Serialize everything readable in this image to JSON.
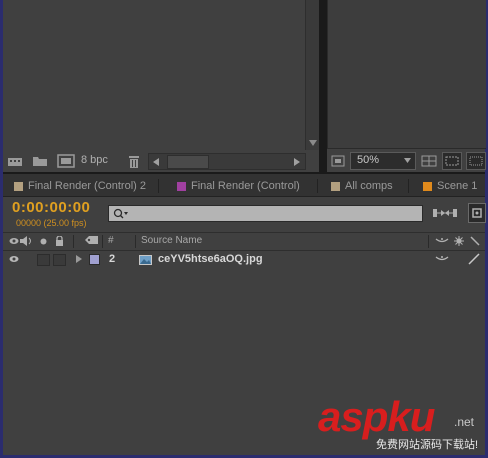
{
  "project_panel": {
    "bit_depth": "8 bpc"
  },
  "viewer_panel": {
    "zoom": "50%"
  },
  "tabs": [
    {
      "label": "Final Render (Control) 2",
      "color": "#b3a080"
    },
    {
      "label": "Final Render (Control)",
      "color": "#a040a0"
    },
    {
      "label": "All comps",
      "color": "#b3a080"
    },
    {
      "label": "Scene 1",
      "color": "#e08a1c"
    }
  ],
  "timeline": {
    "timecode": "0:00:00:00",
    "frame_info": "00000 (25.00 fps)",
    "search_placeholder": "",
    "columns": {
      "number": "#",
      "source_name": "Source Name"
    },
    "layers": [
      {
        "number": "2",
        "name": "ceYV5htse6aOQ.jpg",
        "label_color": "#a0a0d0"
      }
    ]
  },
  "watermark": {
    "brand": "aspku",
    "suffix": ".net",
    "tagline": "免费网站源码下载站!"
  },
  "colors": {
    "panel_bg": "#404040",
    "timecode": "#e0a020",
    "frame_info": "#d09020",
    "frame_border": "#2b2c6e"
  }
}
